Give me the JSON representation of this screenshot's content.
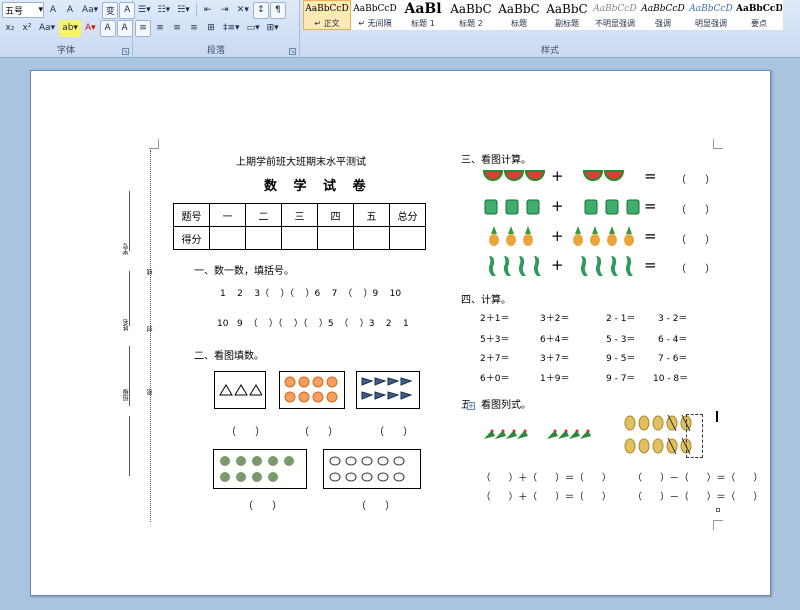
{
  "ribbon": {
    "font_size": "五号",
    "groups": {
      "font": "字体",
      "paragraph": "段落",
      "styles": "样式"
    },
    "font_buttons_row1": [
      "A",
      "A",
      "Aa▾",
      "变",
      "A"
    ],
    "font_buttons_row2": [
      "x₂",
      "x²",
      "Aa▾",
      "ab▾",
      "A▾",
      "A",
      "A"
    ],
    "para_row2_glyphs": [
      "≡",
      "≡",
      "≡",
      "≡",
      "⊞",
      "‡≡▾",
      "▭▾",
      "⊞▾"
    ],
    "styles": [
      {
        "sample": "AaBbCcD",
        "name": "↵ 正文"
      },
      {
        "sample": "AaBbCcD",
        "name": "↵ 无间隔"
      },
      {
        "sample": "AaBl",
        "name": "标题 1"
      },
      {
        "sample": "AaBbC",
        "name": "标题 2"
      },
      {
        "sample": "AaBbC",
        "name": "标题"
      },
      {
        "sample": "AaBbC",
        "name": "副标题"
      },
      {
        "sample": "AaBbCcD",
        "name": "不明显强调"
      },
      {
        "sample": "AaBbCcD",
        "name": "强调"
      },
      {
        "sample": "AaBbCcD",
        "name": "明显强调"
      },
      {
        "sample": "AaBbCcD",
        "name": "要点"
      }
    ]
  },
  "doc": {
    "title": "上期学前班大班期末水平测试",
    "subject": "数 学 试 卷",
    "score_table": {
      "headers": [
        "题号",
        "一",
        "二",
        "三",
        "四",
        "五",
        "总分"
      ],
      "row_label": "得分"
    },
    "binding": {
      "class": "班级",
      "name": "姓名",
      "no": "学号",
      "line": "线",
      "seal": "封",
      "dense": "密"
    },
    "section1": {
      "title": "一、数一数，填括号。",
      "row1": "1    2    3（    ）（    ）6    7  （    ）9    10",
      "row2": "10   9  （    ）（    ）（    ）5  （    ）3    2    1"
    },
    "section2": {
      "title": "二、看图填数。",
      "blank": "（      ）"
    },
    "section3": {
      "title": "三、看图计算。",
      "plus": "+",
      "eq": "=",
      "blank": "（      ）"
    },
    "section4": {
      "title": "四、计算。",
      "rows": [
        [
          "2＋1＝",
          "3＋2＝",
          "2 - 1＝",
          "3 - 2＝"
        ],
        [
          "5＋3＝",
          "6＋4＝",
          "5 - 3＝",
          "6 - 4＝"
        ],
        [
          "2＋7＝",
          "3＋7＝",
          "9 - 5＝",
          "7 - 6＝"
        ],
        [
          "6＋0＝",
          "1＋9＝",
          "9 - 7＝",
          "10 - 8＝"
        ]
      ]
    },
    "section5": {
      "title": "五、看图列式。",
      "line1": "（      ）＋（      ）＝（      ）       （      ）－（      ）＝（      ）",
      "line2": "（      ）＋（      ）＝（      ）       （      ）－（      ）＝（      ）"
    }
  }
}
